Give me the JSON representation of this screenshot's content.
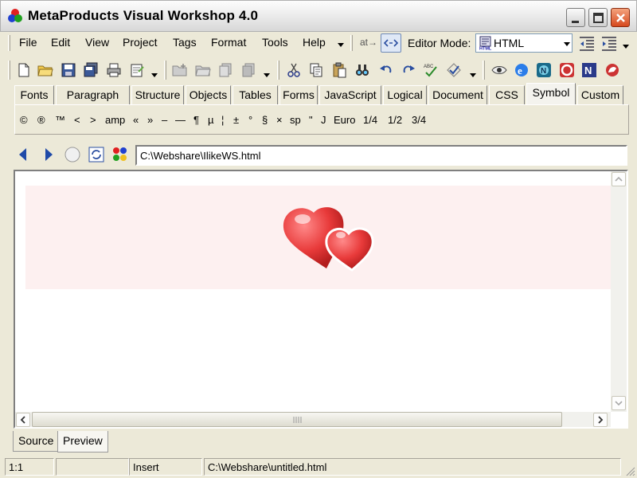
{
  "window": {
    "title": "MetaProducts Visual Workshop 4.0"
  },
  "menu": {
    "items": [
      "File",
      "Edit",
      "View",
      "Project",
      "Tags",
      "Format",
      "Tools",
      "Help"
    ]
  },
  "toolbar": {
    "editor_mode_label": "Editor Mode:",
    "editor_mode_value": "HTML",
    "at_label": "at→"
  },
  "tabs": [
    "Fonts",
    "Paragraph",
    "Structure",
    "Objects",
    "Tables",
    "Forms",
    "JavaScript",
    "Logical",
    "Document",
    "CSS",
    "Symbol",
    "Custom"
  ],
  "active_tab": "Symbol",
  "symbols": [
    "©",
    "®",
    "™",
    "<",
    ">",
    "amp",
    "«",
    "»",
    "–",
    "—",
    "¶",
    "µ",
    "¦",
    "±",
    "°",
    "§",
    "×",
    "sp",
    "\"",
    "J",
    "Euro",
    "1/4",
    "1/2",
    "3/4"
  ],
  "nav": {
    "url": "C:\\Webshare\\IlikeWS.html"
  },
  "bottom_tabs": {
    "source": "Source",
    "preview": "Preview"
  },
  "status": {
    "position": "1:1",
    "mode": "Insert",
    "file": "C:\\Webshare\\untitled.html"
  },
  "colors": {
    "heart": "#e83a3a",
    "banner_bg": "#fdf0f0"
  }
}
